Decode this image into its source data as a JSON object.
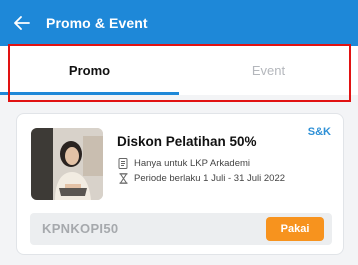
{
  "appbar": {
    "title": "Promo & Event",
    "back_icon": "arrow-left-icon"
  },
  "tabs": [
    {
      "label": "Promo",
      "active": true
    },
    {
      "label": "Event",
      "active": false
    }
  ],
  "colors": {
    "primary": "#1e88d8",
    "accent_orange": "#f7931e",
    "highlight_red": "#e11212"
  },
  "promo_card": {
    "tag": "S&K",
    "title": "Diskon Pelatihan 50%",
    "details": [
      {
        "icon": "document-icon",
        "text": "Hanya untuk LKP Arkademi"
      },
      {
        "icon": "hourglass-icon",
        "text": "Periode berlaku 1 Juli - 31 Juli 2022"
      }
    ],
    "code": "KPNKOPI50",
    "button_label": "Pakai"
  }
}
